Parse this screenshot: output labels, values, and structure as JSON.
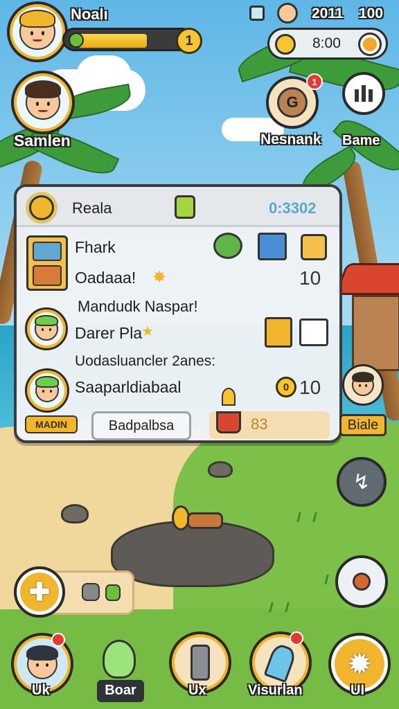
{
  "player": {
    "name": "Noalı",
    "level": "1",
    "xp_fill": 0.55
  },
  "top_stats": {
    "stat_a": "2011",
    "stat_b": "100",
    "timer": "8:00"
  },
  "left_npc": {
    "name": "Samlen"
  },
  "top_buttons": {
    "news": {
      "label": "Nesnank",
      "badge": "1"
    },
    "game": {
      "label": "Bame"
    }
  },
  "panel": {
    "title": "Reala",
    "counter": "0:3302",
    "rows": [
      {
        "title": "Fhark",
        "subtitle": "Oadaaa!",
        "value": "10"
      },
      {
        "heading": "Mandudk Naspar!",
        "title": "Darer Pla",
        "heading2": "Uodasluancler 2anes:"
      },
      {
        "title": "Saaparldiabaal",
        "value": "10",
        "coin": "0",
        "tag": "MADIN"
      }
    ],
    "button_label": "Badpalbsa",
    "progress_value": "83"
  },
  "right_npc": {
    "name": "Biale"
  },
  "bottom_nav": [
    {
      "label": "Uk"
    },
    {
      "label": "Boar"
    },
    {
      "label": "Ux"
    },
    {
      "label": "Visurlan"
    },
    {
      "label": "UI"
    }
  ],
  "colors": {
    "accent": "#f2b62c",
    "panel_bg": "#eef1f3",
    "outline": "#2a2a2a",
    "badge": "#e53935"
  }
}
